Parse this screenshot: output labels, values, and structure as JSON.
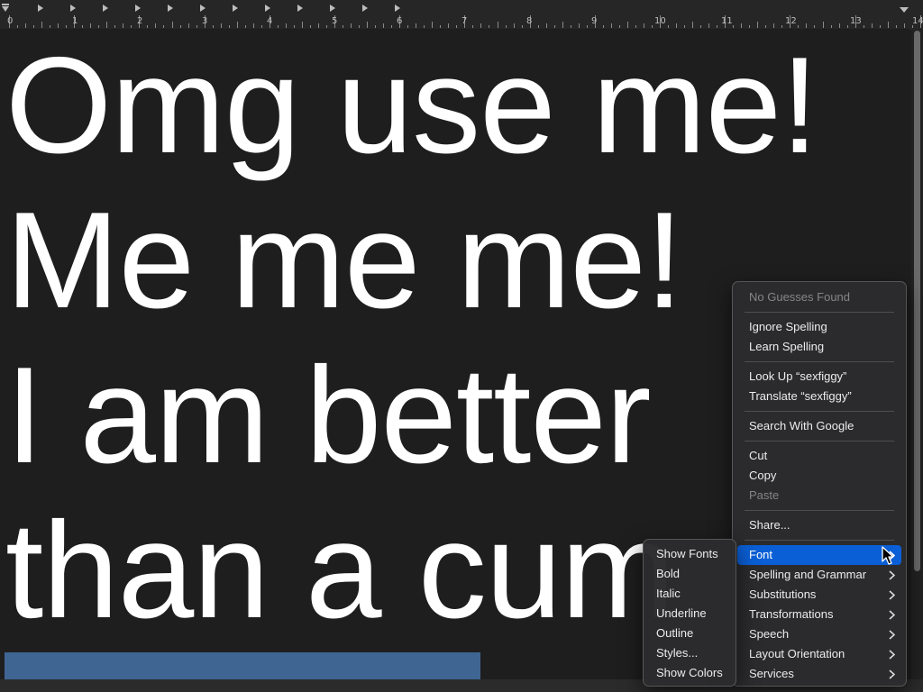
{
  "ruler": {
    "numbers": [
      "0",
      "1",
      "2",
      "3",
      "4",
      "5",
      "6",
      "7",
      "8",
      "9",
      "10",
      "11",
      "12",
      "13",
      "14"
    ]
  },
  "document": {
    "lines": [
      "Omg use me!",
      "Me me me!",
      "I am better",
      "than a cum"
    ]
  },
  "context_menu": {
    "no_guesses": "No Guesses Found",
    "ignore_spelling": "Ignore Spelling",
    "learn_spelling": "Learn Spelling",
    "look_up": "Look Up “sexfiggy”",
    "translate": "Translate “sexfiggy”",
    "search_google": "Search With Google",
    "cut": "Cut",
    "copy": "Copy",
    "paste": "Paste",
    "share": "Share...",
    "font": "Font",
    "spelling_grammar": "Spelling and Grammar",
    "substitutions": "Substitutions",
    "transformations": "Transformations",
    "speech": "Speech",
    "layout_orientation": "Layout Orientation",
    "services": "Services"
  },
  "font_submenu": {
    "show_fonts": "Show Fonts",
    "bold": "Bold",
    "italic": "Italic",
    "underline": "Underline",
    "outline": "Outline",
    "styles": "Styles...",
    "show_colors": "Show Colors"
  },
  "colors": {
    "highlight": "#0a5fd6",
    "selection": "#3f6592",
    "background": "#1e1e1e",
    "text": "#ffffff"
  }
}
